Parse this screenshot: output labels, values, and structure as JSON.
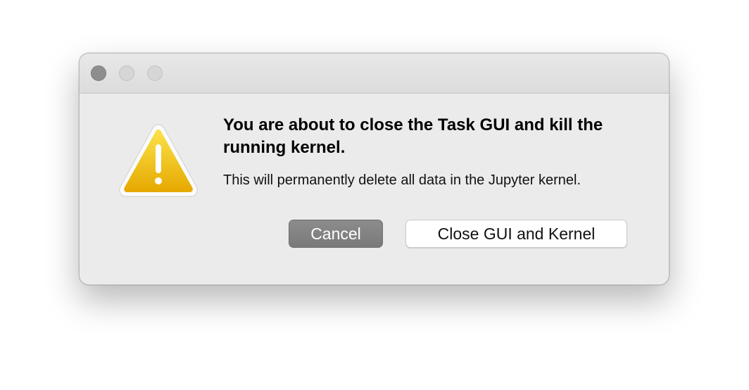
{
  "dialog": {
    "heading": "You are about to close the Task GUI and kill the running kernel.",
    "message": "This will permanently delete all data in the Jupyter kernel.",
    "icon": "warning-icon",
    "buttons": {
      "cancel_label": "Cancel",
      "confirm_label": "Close GUI and Kernel"
    }
  },
  "window_controls": [
    "close-icon",
    "minimize-icon",
    "zoom-icon"
  ],
  "colors": {
    "window_bg": "#ebebeb",
    "cancel_button_bg": "#808080",
    "warning_yellow": "#f3c000"
  }
}
